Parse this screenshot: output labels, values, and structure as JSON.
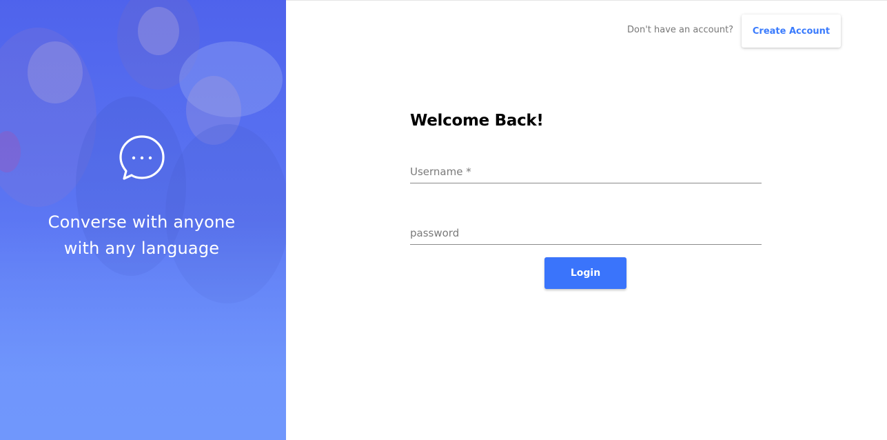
{
  "hero": {
    "tagline_line1": "Converse with anyone",
    "tagline_line2": "with any language",
    "icon": "chat-bubble-icon",
    "gradient_top": "#4f63ec",
    "gradient_bottom": "#7097fc"
  },
  "header": {
    "signup_prompt": "Don't have an account?",
    "create_account_label": "Create Account"
  },
  "form": {
    "title": "Welcome Back!",
    "username_label": "Username *",
    "password_label": "password",
    "login_label": "Login"
  },
  "colors": {
    "accent": "#3a74fb",
    "link": "#3a7bfd"
  }
}
